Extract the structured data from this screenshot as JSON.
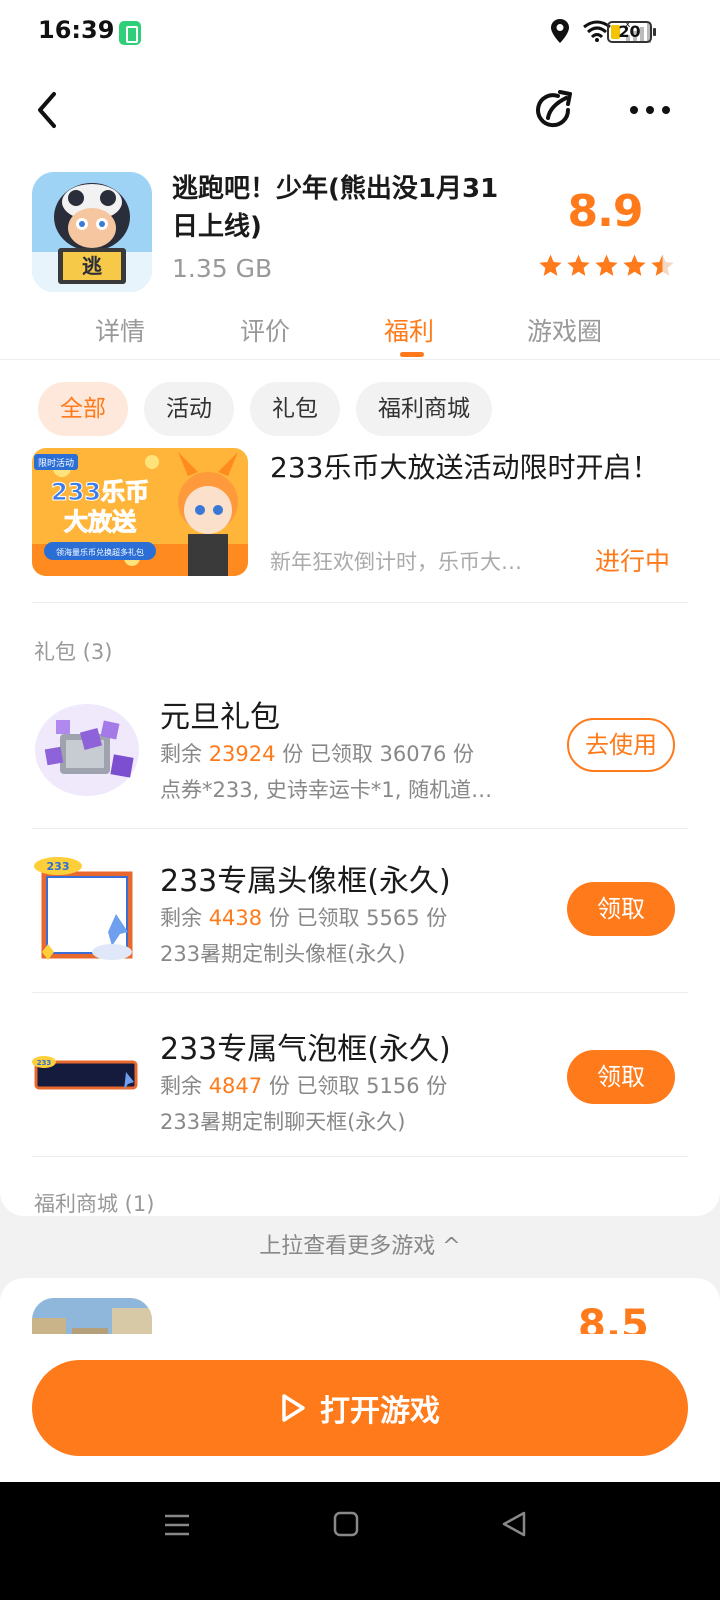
{
  "status_bar": {
    "time": "16:39",
    "battery": "20"
  },
  "game": {
    "title": "逃跑吧！少年(熊出没1月31日上线)",
    "size": "1.35 GB",
    "rating": "8.9",
    "rating_value": 4.5,
    "icon_text": "逃"
  },
  "tabs": [
    "详情",
    "评价",
    "福利",
    "游戏圈"
  ],
  "active_tab": "福利",
  "filter_chips": [
    "全部",
    "活动",
    "礼包",
    "福利商城"
  ],
  "activity": {
    "title": "233乐币大放送活动限时开启！",
    "desc": "新年狂欢倒计时，乐币大…",
    "status": "进行中",
    "banner_tag": "限时活动",
    "banner_title_1": "233乐币",
    "banner_title_2": "大放送",
    "banner_sub": "领海量乐币兑换超多礼包"
  },
  "gift_section": {
    "label": "礼包 (3)"
  },
  "gifts": [
    {
      "name": "元旦礼包",
      "remain_label": "剩余",
      "remain": "23924",
      "claimed_label": "份 已领取 36076 份",
      "desc": "点券*233, 史诗幸运卡*1, 随机道…",
      "button": "去使用"
    },
    {
      "name": "233专属头像框(永久)",
      "remain_label": "剩余",
      "remain": "4438",
      "claimed_label": "份 已领取 5565 份",
      "desc": "233暑期定制头像框(永久)",
      "button": "领取"
    },
    {
      "name": "233专属气泡框(永久)",
      "remain_label": "剩余",
      "remain": "4847",
      "claimed_label": "份 已领取 5156 份",
      "desc": "233暑期定制聊天框(永久)",
      "button": "领取"
    }
  ],
  "shop_section": {
    "label": "福利商城 (1)"
  },
  "pull_hint": "上拉查看更多游戏 ^",
  "next_game": {
    "score": "8.5"
  },
  "open_button": "打开游戏",
  "colors": {
    "accent": "#ff7a1a",
    "chip_active_bg": "#fde8db"
  }
}
